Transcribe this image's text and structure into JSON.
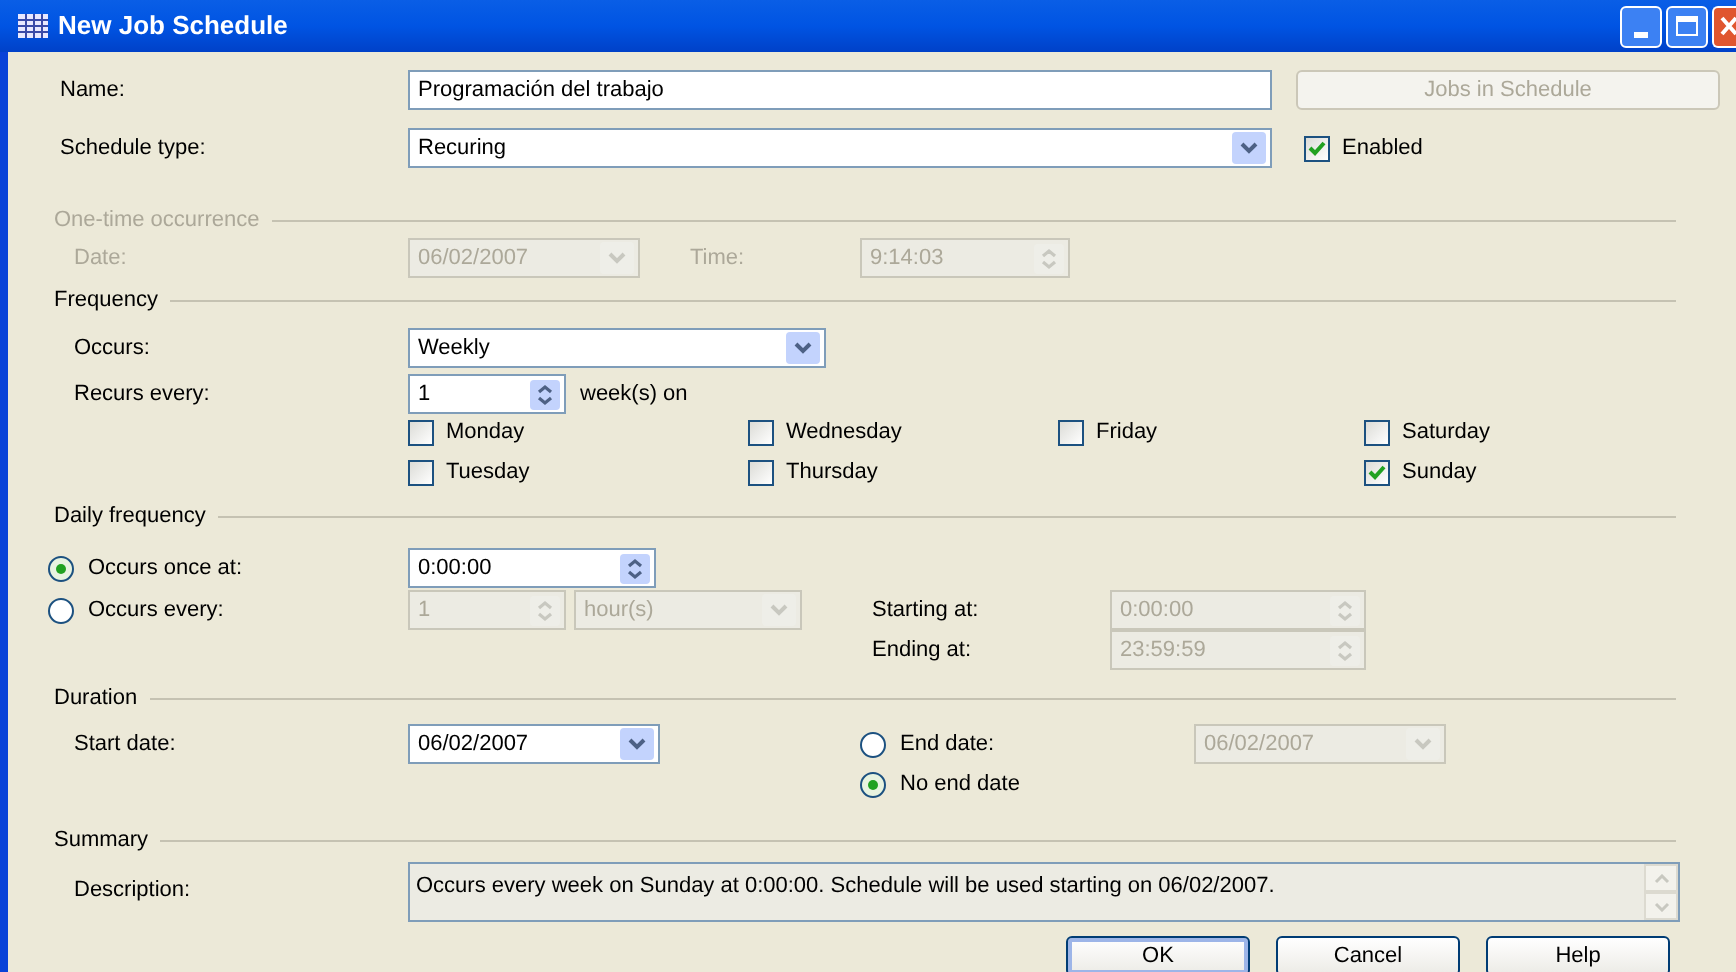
{
  "window": {
    "title": "New Job Schedule"
  },
  "name": {
    "label": "Name:",
    "value": "Programación del trabajo"
  },
  "jobs_button": {
    "label": "Jobs in Schedule",
    "disabled": true
  },
  "schedule_type": {
    "label": "Schedule type:",
    "value": "Recuring"
  },
  "enabled": {
    "label": "Enabled",
    "checked": true
  },
  "one_time": {
    "title": "One-time occurrence",
    "disabled": true,
    "date_label": "Date:",
    "date": "06/02/2007",
    "time_label": "Time:",
    "time": "9:14:03"
  },
  "frequency": {
    "title": "Frequency",
    "occurs_label": "Occurs:",
    "occurs": "Weekly",
    "recurs_label": "Recurs every:",
    "recurs_value": "1",
    "recurs_unit": "week(s) on",
    "day_columns": [
      {
        "days": [
          {
            "label": "Monday",
            "checked": false
          },
          {
            "label": "Tuesday",
            "checked": false
          }
        ]
      },
      {
        "days": [
          {
            "label": "Wednesday",
            "checked": false
          },
          {
            "label": "Thursday",
            "checked": false
          }
        ]
      },
      {
        "days": [
          {
            "label": "Friday",
            "checked": false
          }
        ]
      },
      {
        "days": [
          {
            "label": "Saturday",
            "checked": false
          },
          {
            "label": "Sunday",
            "checked": true
          }
        ]
      }
    ]
  },
  "daily_frequency": {
    "title": "Daily frequency",
    "options": [
      {
        "label": "Occurs once at:",
        "selected": true
      },
      {
        "label": "Occurs every:",
        "selected": false
      }
    ],
    "once_time": "0:00:00",
    "every_value": "1",
    "every_unit": "hour(s)",
    "every_disabled": true,
    "starting_label": "Starting at:",
    "starting": "0:00:00",
    "ending_label": "Ending at:",
    "ending": "23:59:59"
  },
  "duration": {
    "title": "Duration",
    "start_label": "Start date:",
    "start_date": "06/02/2007",
    "end_options": [
      {
        "label": "End date:",
        "selected": false
      },
      {
        "label": "No end date",
        "selected": true
      }
    ],
    "end_date": "06/02/2007",
    "end_date_disabled": true
  },
  "summary": {
    "title": "Summary",
    "description_label": "Description:",
    "description": "Occurs every week on Sunday at 0:00:00. Schedule will be used starting on 06/02/2007."
  },
  "buttons": [
    {
      "label": "OK",
      "default": true
    },
    {
      "label": "Cancel",
      "default": false
    },
    {
      "label": "Help",
      "default": false
    }
  ]
}
